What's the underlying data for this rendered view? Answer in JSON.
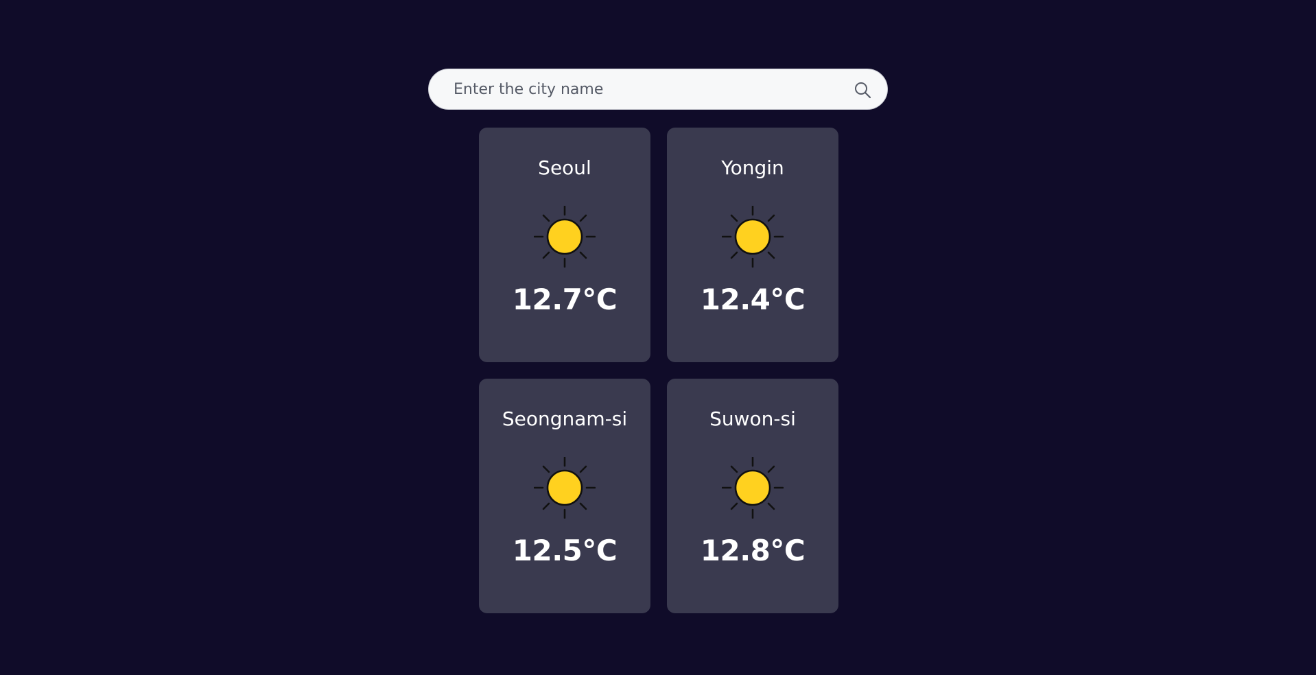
{
  "search": {
    "placeholder": "Enter the city name",
    "value": ""
  },
  "cards": [
    {
      "city": "Seoul",
      "temperature": "12.7°C",
      "icon": "sun-icon"
    },
    {
      "city": "Yongin",
      "temperature": "12.4°C",
      "icon": "sun-icon"
    },
    {
      "city": "Seongnam-si",
      "temperature": "12.5°C",
      "icon": "sun-icon"
    },
    {
      "city": "Suwon-si",
      "temperature": "12.8°C",
      "icon": "sun-icon"
    }
  ],
  "colors": {
    "background": "#100c29",
    "card": "#3a3a4f",
    "sun_fill": "#ffd11f",
    "text": "#ffffff"
  }
}
